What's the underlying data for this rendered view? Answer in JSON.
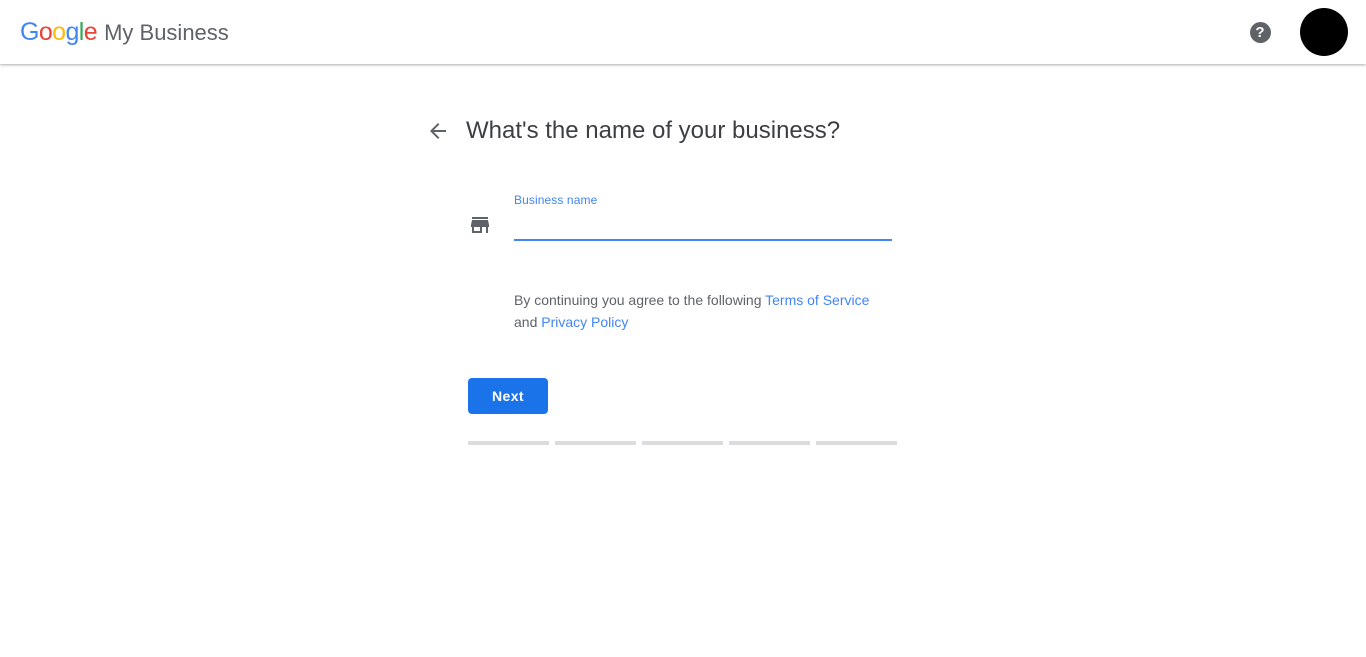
{
  "header": {
    "logo_google_letters": [
      "G",
      "o",
      "o",
      "g",
      "l",
      "e"
    ],
    "brand_suffix": "My Business",
    "help_glyph": "?",
    "help_label": "Help",
    "avatar_label": "Account"
  },
  "main": {
    "back_label": "Back",
    "page_title": "What's the name of your business?",
    "field": {
      "icon_name": "storefront-icon",
      "label": "Business name",
      "value": "",
      "placeholder": ""
    },
    "terms": {
      "prefix": "By continuing you agree to the following ",
      "terms_link": "Terms of Service",
      "conjunction": " and ",
      "privacy_link": "Privacy Policy"
    },
    "next_label": "Next",
    "progress": {
      "segments": 5,
      "completed": 0
    }
  },
  "illustration": {
    "name": "business-sign-cityscape",
    "sign_colors": {
      "header_bar": "#4285F4",
      "stars": "#FBBC05",
      "block_left": "#EA4335",
      "block_right": "#34A853"
    }
  },
  "colors": {
    "accent_blue": "#4285F4",
    "button_blue": "#1A73E8",
    "text_primary": "#3C4043",
    "text_secondary": "#5F6368",
    "progress_gray": "#DADCE0",
    "google_blue": "#4285F4",
    "google_red": "#EA4335",
    "google_yellow": "#FBBC05",
    "google_green": "#34A853"
  }
}
